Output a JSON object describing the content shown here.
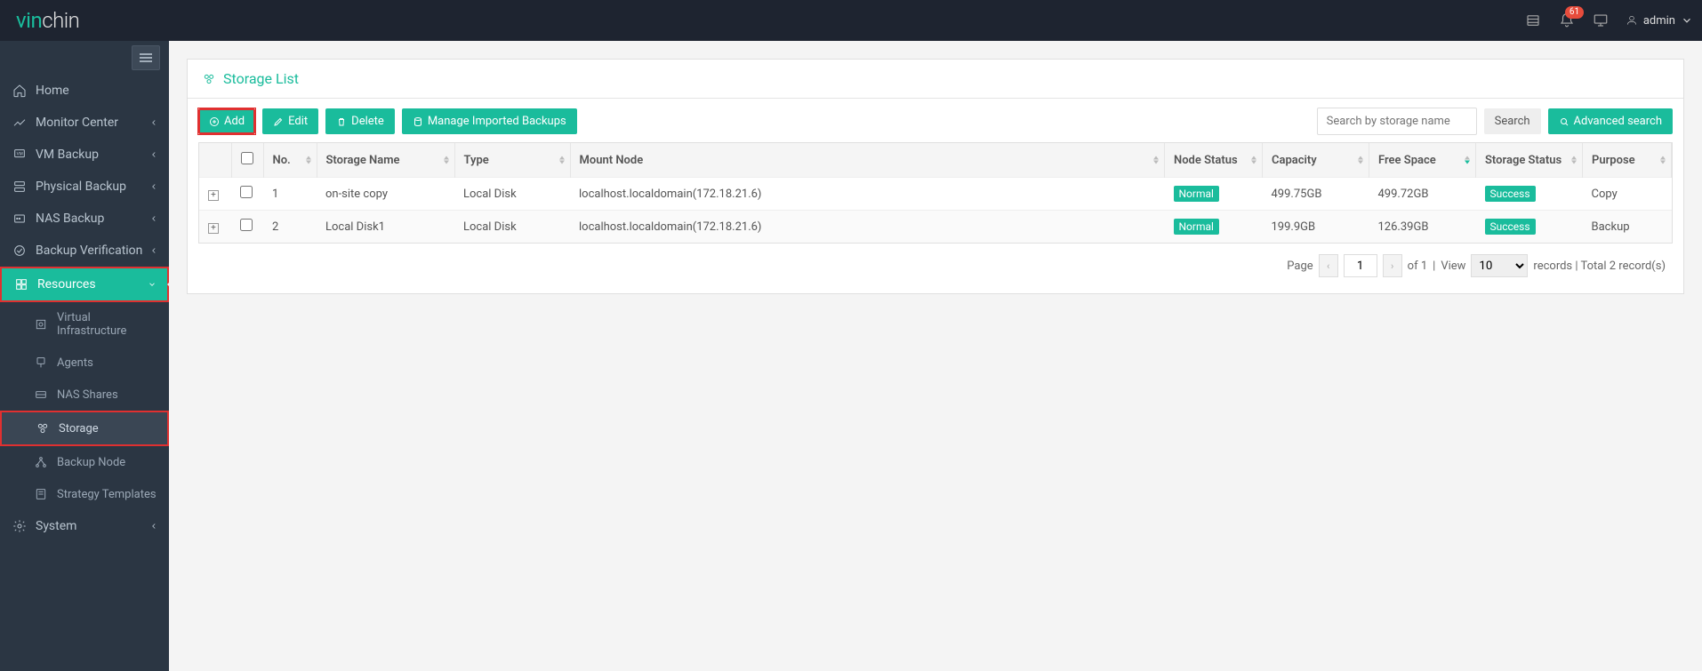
{
  "topbar": {
    "logo1": "vin",
    "logo2": "chin",
    "notify_count": "61",
    "user": "admin"
  },
  "sidebar": {
    "items": [
      {
        "icon": "home",
        "label": "Home",
        "chev": false
      },
      {
        "icon": "chart",
        "label": "Monitor Center",
        "chev": true
      },
      {
        "icon": "vm",
        "label": "VM Backup",
        "chev": true
      },
      {
        "icon": "server",
        "label": "Physical Backup",
        "chev": true
      },
      {
        "icon": "nas",
        "label": "NAS Backup",
        "chev": true
      },
      {
        "icon": "verify",
        "label": "Backup Verification",
        "chev": true
      },
      {
        "icon": "resources",
        "label": "Resources",
        "chev": true,
        "active": true
      },
      {
        "icon": "system",
        "label": "System",
        "chev": true
      }
    ],
    "sub_resources": [
      {
        "icon": "vi",
        "label": "Virtual Infrastructure"
      },
      {
        "icon": "agent",
        "label": "Agents"
      },
      {
        "icon": "nas-sh",
        "label": "NAS Shares"
      },
      {
        "icon": "storage",
        "label": "Storage",
        "active": true
      },
      {
        "icon": "node",
        "label": "Backup Node"
      },
      {
        "icon": "tpl",
        "label": "Strategy Templates"
      }
    ]
  },
  "panel": {
    "title": "Storage List"
  },
  "toolbar": {
    "add": "Add",
    "edit": "Edit",
    "delete": "Delete",
    "manage": "Manage Imported Backups",
    "search_placeholder": "Search by storage name",
    "search_btn": "Search",
    "advanced": "Advanced search"
  },
  "table": {
    "headers": {
      "no": "No.",
      "name": "Storage Name",
      "type": "Type",
      "mount": "Mount Node",
      "node_status": "Node Status",
      "capacity": "Capacity",
      "free": "Free Space",
      "sstatus": "Storage Status",
      "purpose": "Purpose"
    },
    "rows": [
      {
        "no": "1",
        "name": "on-site copy",
        "type": "Local Disk",
        "mount": "localhost.localdomain(172.18.21.6)",
        "node_status": "Normal",
        "capacity": "499.75GB",
        "free": "499.72GB",
        "sstatus": "Success",
        "purpose": "Copy"
      },
      {
        "no": "2",
        "name": "Local Disk1",
        "type": "Local Disk",
        "mount": "localhost.localdomain(172.18.21.6)",
        "node_status": "Normal",
        "capacity": "199.9GB",
        "free": "126.39GB",
        "sstatus": "Success",
        "purpose": "Backup"
      }
    ]
  },
  "pager": {
    "page_label": "Page",
    "current": "1",
    "of_label": "of 1",
    "view_label": "View",
    "page_size": "10",
    "tail": "records | Total 2 record(s)"
  }
}
